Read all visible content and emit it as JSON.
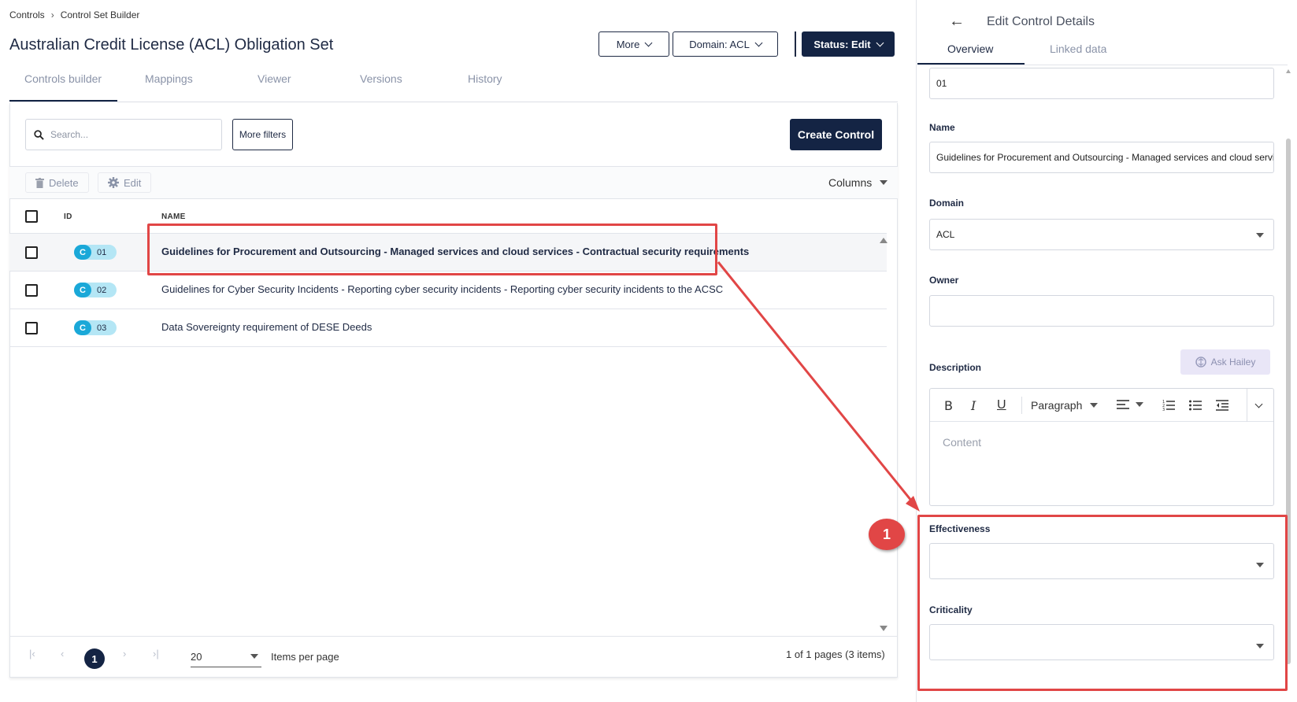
{
  "breadcrumb": {
    "root": "Controls",
    "current": "Control Set Builder"
  },
  "page_title": "Australian Credit License (ACL) Obligation Set",
  "header_buttons": {
    "more": "More",
    "domain": "Domain: ACL",
    "status": "Status: Edit"
  },
  "tabs": [
    "Controls builder",
    "Mappings",
    "Viewer",
    "Versions",
    "History"
  ],
  "search": {
    "placeholder": "Search..."
  },
  "more_filters": "More filters",
  "create_control": "Create Control",
  "toolbar": {
    "delete": "Delete",
    "edit": "Edit",
    "columns": "Columns"
  },
  "table": {
    "headers": {
      "id": "ID",
      "name": "NAME"
    },
    "rows": [
      {
        "badge": "C",
        "id": "01",
        "name": "Guidelines for Procurement and Outsourcing - Managed services and cloud services - Contractual security requirements"
      },
      {
        "badge": "C",
        "id": "02",
        "name": "Guidelines for Cyber Security Incidents - Reporting cyber security incidents - Reporting cyber security incidents to the ACSC"
      },
      {
        "badge": "C",
        "id": "03",
        "name": "Data Sovereignty requirement of DESE Deeds"
      }
    ]
  },
  "pagination": {
    "current_page": "1",
    "page_size": "20",
    "items_per_page": "Items per page",
    "info": "1 of 1 pages (3 items)"
  },
  "panel": {
    "title": "Edit Control Details",
    "tabs": [
      "Overview",
      "Linked data"
    ],
    "id_value": "01",
    "name_label": "Name",
    "name_value": "Guidelines for Procurement and Outsourcing - Managed services and cloud services - Contractual security requirements",
    "domain_label": "Domain",
    "domain_value": "ACL",
    "owner_label": "Owner",
    "owner_value": "",
    "description_label": "Description",
    "ask_hailey": "Ask Hailey",
    "editor": {
      "bold": "B",
      "italic": "I",
      "underline": "U",
      "paragraph": "Paragraph",
      "content_placeholder": "Content"
    },
    "effectiveness_label": "Effectiveness",
    "effectiveness_value": "",
    "criticality_label": "Criticality",
    "criticality_value": ""
  },
  "annotation": {
    "marker": "1",
    "color": "#e14646"
  },
  "colors": {
    "primary": "#142444",
    "badge": "#1aa8d8",
    "badge_bg": "#b4e6f5"
  }
}
